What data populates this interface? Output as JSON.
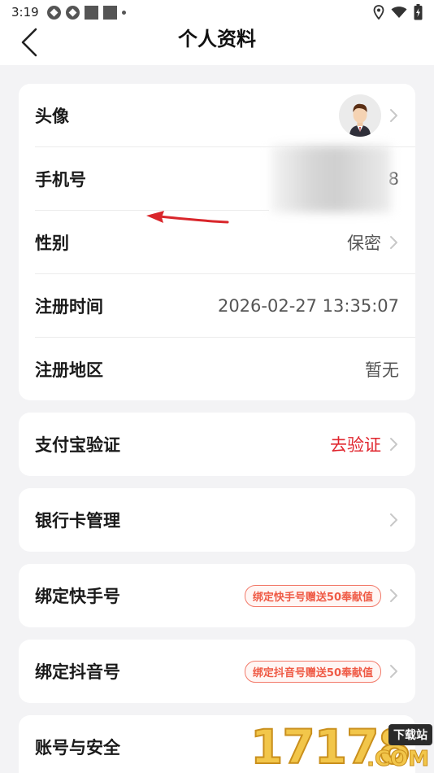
{
  "status": {
    "time": "3:19"
  },
  "header": {
    "title": "个人资料",
    "back_icon": "chevron-left-icon"
  },
  "profile": {
    "avatar_label": "头像",
    "phone_label": "手机号",
    "phone_value_visible": "8",
    "gender_label": "性别",
    "gender_value": "保密",
    "reg_time_label": "注册时间",
    "reg_time_value": "2026-02-27 13:35:07",
    "reg_region_label": "注册地区",
    "reg_region_value": "暂无"
  },
  "alipay": {
    "label": "支付宝验证",
    "action": "去验证",
    "action_color": "#e0262e"
  },
  "bank": {
    "label": "银行卡管理"
  },
  "kuaishou": {
    "label": "绑定快手号",
    "badge": "绑定快手号赠送50奉献值"
  },
  "douyin": {
    "label": "绑定抖音号",
    "badge": "绑定抖音号赠送50奉献值"
  },
  "security": {
    "label": "账号与安全"
  },
  "watermark": {
    "digits": "17178",
    "tag": "下载站",
    "domain": ".COM"
  }
}
